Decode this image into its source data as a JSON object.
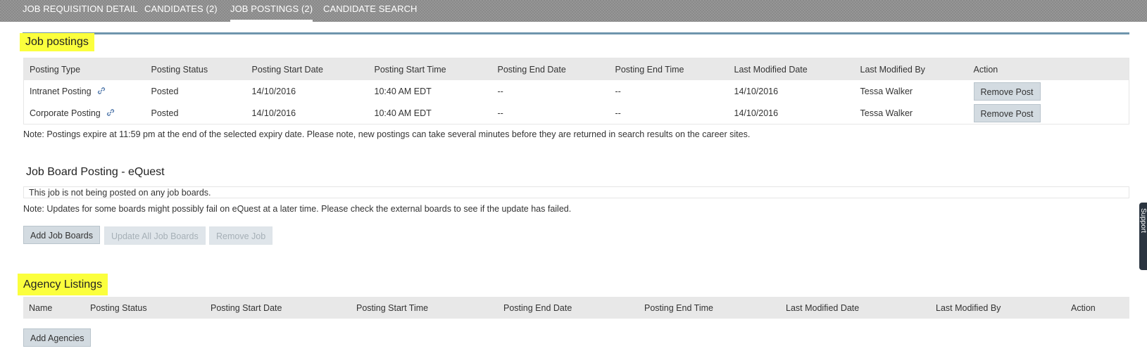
{
  "tabs": [
    {
      "label": "JOB REQUISITION DETAIL",
      "active": false
    },
    {
      "label": "CANDIDATES (2)",
      "active": false
    },
    {
      "label": "JOB POSTINGS (2)",
      "active": true
    },
    {
      "label": "CANDIDATE SEARCH",
      "active": false
    }
  ],
  "job_postings": {
    "title": "Job postings",
    "columns": [
      "Posting Type",
      "Posting Status",
      "Posting Start Date",
      "Posting Start Time",
      "Posting End Date",
      "Posting End Time",
      "Last Modified Date",
      "Last Modified By",
      "Action"
    ],
    "rows": [
      {
        "type": "Intranet Posting",
        "status": "Posted",
        "start_date": "14/10/2016",
        "start_time": "10:40 AM EDT",
        "end_date": "--",
        "end_time": "--",
        "modified_date": "14/10/2016",
        "modified_by": "Tessa Walker",
        "action": "Remove Post"
      },
      {
        "type": "Corporate Posting",
        "status": "Posted",
        "start_date": "14/10/2016",
        "start_time": "10:40 AM EDT",
        "end_date": "--",
        "end_time": "--",
        "modified_date": "14/10/2016",
        "modified_by": "Tessa Walker",
        "action": "Remove Post"
      }
    ],
    "note": "Note: Postings expire at 11:59 pm at the end of the selected expiry date. Please note, new postings can take several minutes before they are returned in search results on the career sites."
  },
  "job_board": {
    "title": "Job Board Posting - eQuest",
    "info": "This job is not being posted on any job boards.",
    "note": "Note: Updates for some boards might possibly fail on eQuest at a later time. Please check the external boards to see if the update has failed.",
    "buttons": {
      "add": "Add Job Boards",
      "update_all": "Update All Job Boards",
      "remove": "Remove Job"
    }
  },
  "agency": {
    "title": "Agency Listings",
    "columns": [
      "Name",
      "Posting Status",
      "Posting Start Date",
      "Posting Start Time",
      "Posting End Date",
      "Posting End Time",
      "Last Modified Date",
      "Last Modified By",
      "Action"
    ],
    "add_button": "Add Agencies"
  },
  "support_tab": "Support",
  "colors": {
    "highlight": "#fbff3d",
    "accent_bar": "#6f95ad",
    "button_bg": "#d3dbe1"
  }
}
